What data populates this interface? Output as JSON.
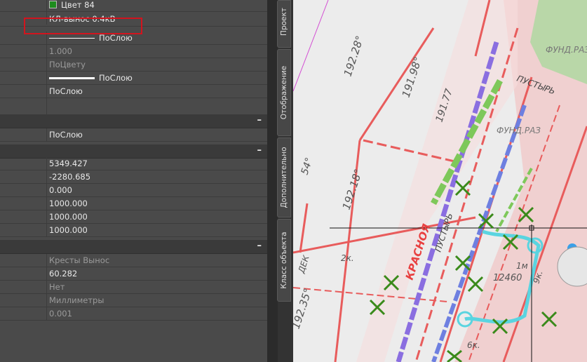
{
  "properties": {
    "color_value": "Цвет 84",
    "color_hex": "#1e8c1e",
    "layer_value": "КЛ-вынос 0.4кВ",
    "linetype_value": "ПоСлою",
    "linetype_scale_value": "1.000",
    "plot_style_value": "ПоЦвету",
    "lineweight_value": "ПоСлою",
    "transparency_value": "ПоСлою"
  },
  "section2": {
    "value": "ПоСлою"
  },
  "geometry": {
    "values": [
      "5349.427",
      "-2280.685",
      "0.000",
      "1000.000",
      "1000.000",
      "1000.000"
    ]
  },
  "misc": {
    "name_value": "Кресты Вынос",
    "rotation_value": "60.282",
    "annotative_value": "Нет",
    "units_value": "Миллиметры",
    "unit_factor_value": "0.001"
  },
  "collapse_label": "–",
  "tabs": [
    "Проект",
    "Отображение",
    "Дополнительно",
    "Класс объекта"
  ],
  "drawing": {
    "labels": [
      "192.28°",
      "191.98°",
      "191.77",
      "192.18°",
      "192.35°",
      "ПУСТЫРЬ",
      "ПУСТЫРЬ",
      "ФУНД.РАЗ",
      "ФУНД.РАЗР",
      "КРАСНОЯ",
      "2к.",
      "6к.",
      "1м",
      "ДЕК",
      "54°",
      "12460",
      "9к."
    ]
  },
  "accent_colors": {
    "highlight": "#d2141e"
  }
}
